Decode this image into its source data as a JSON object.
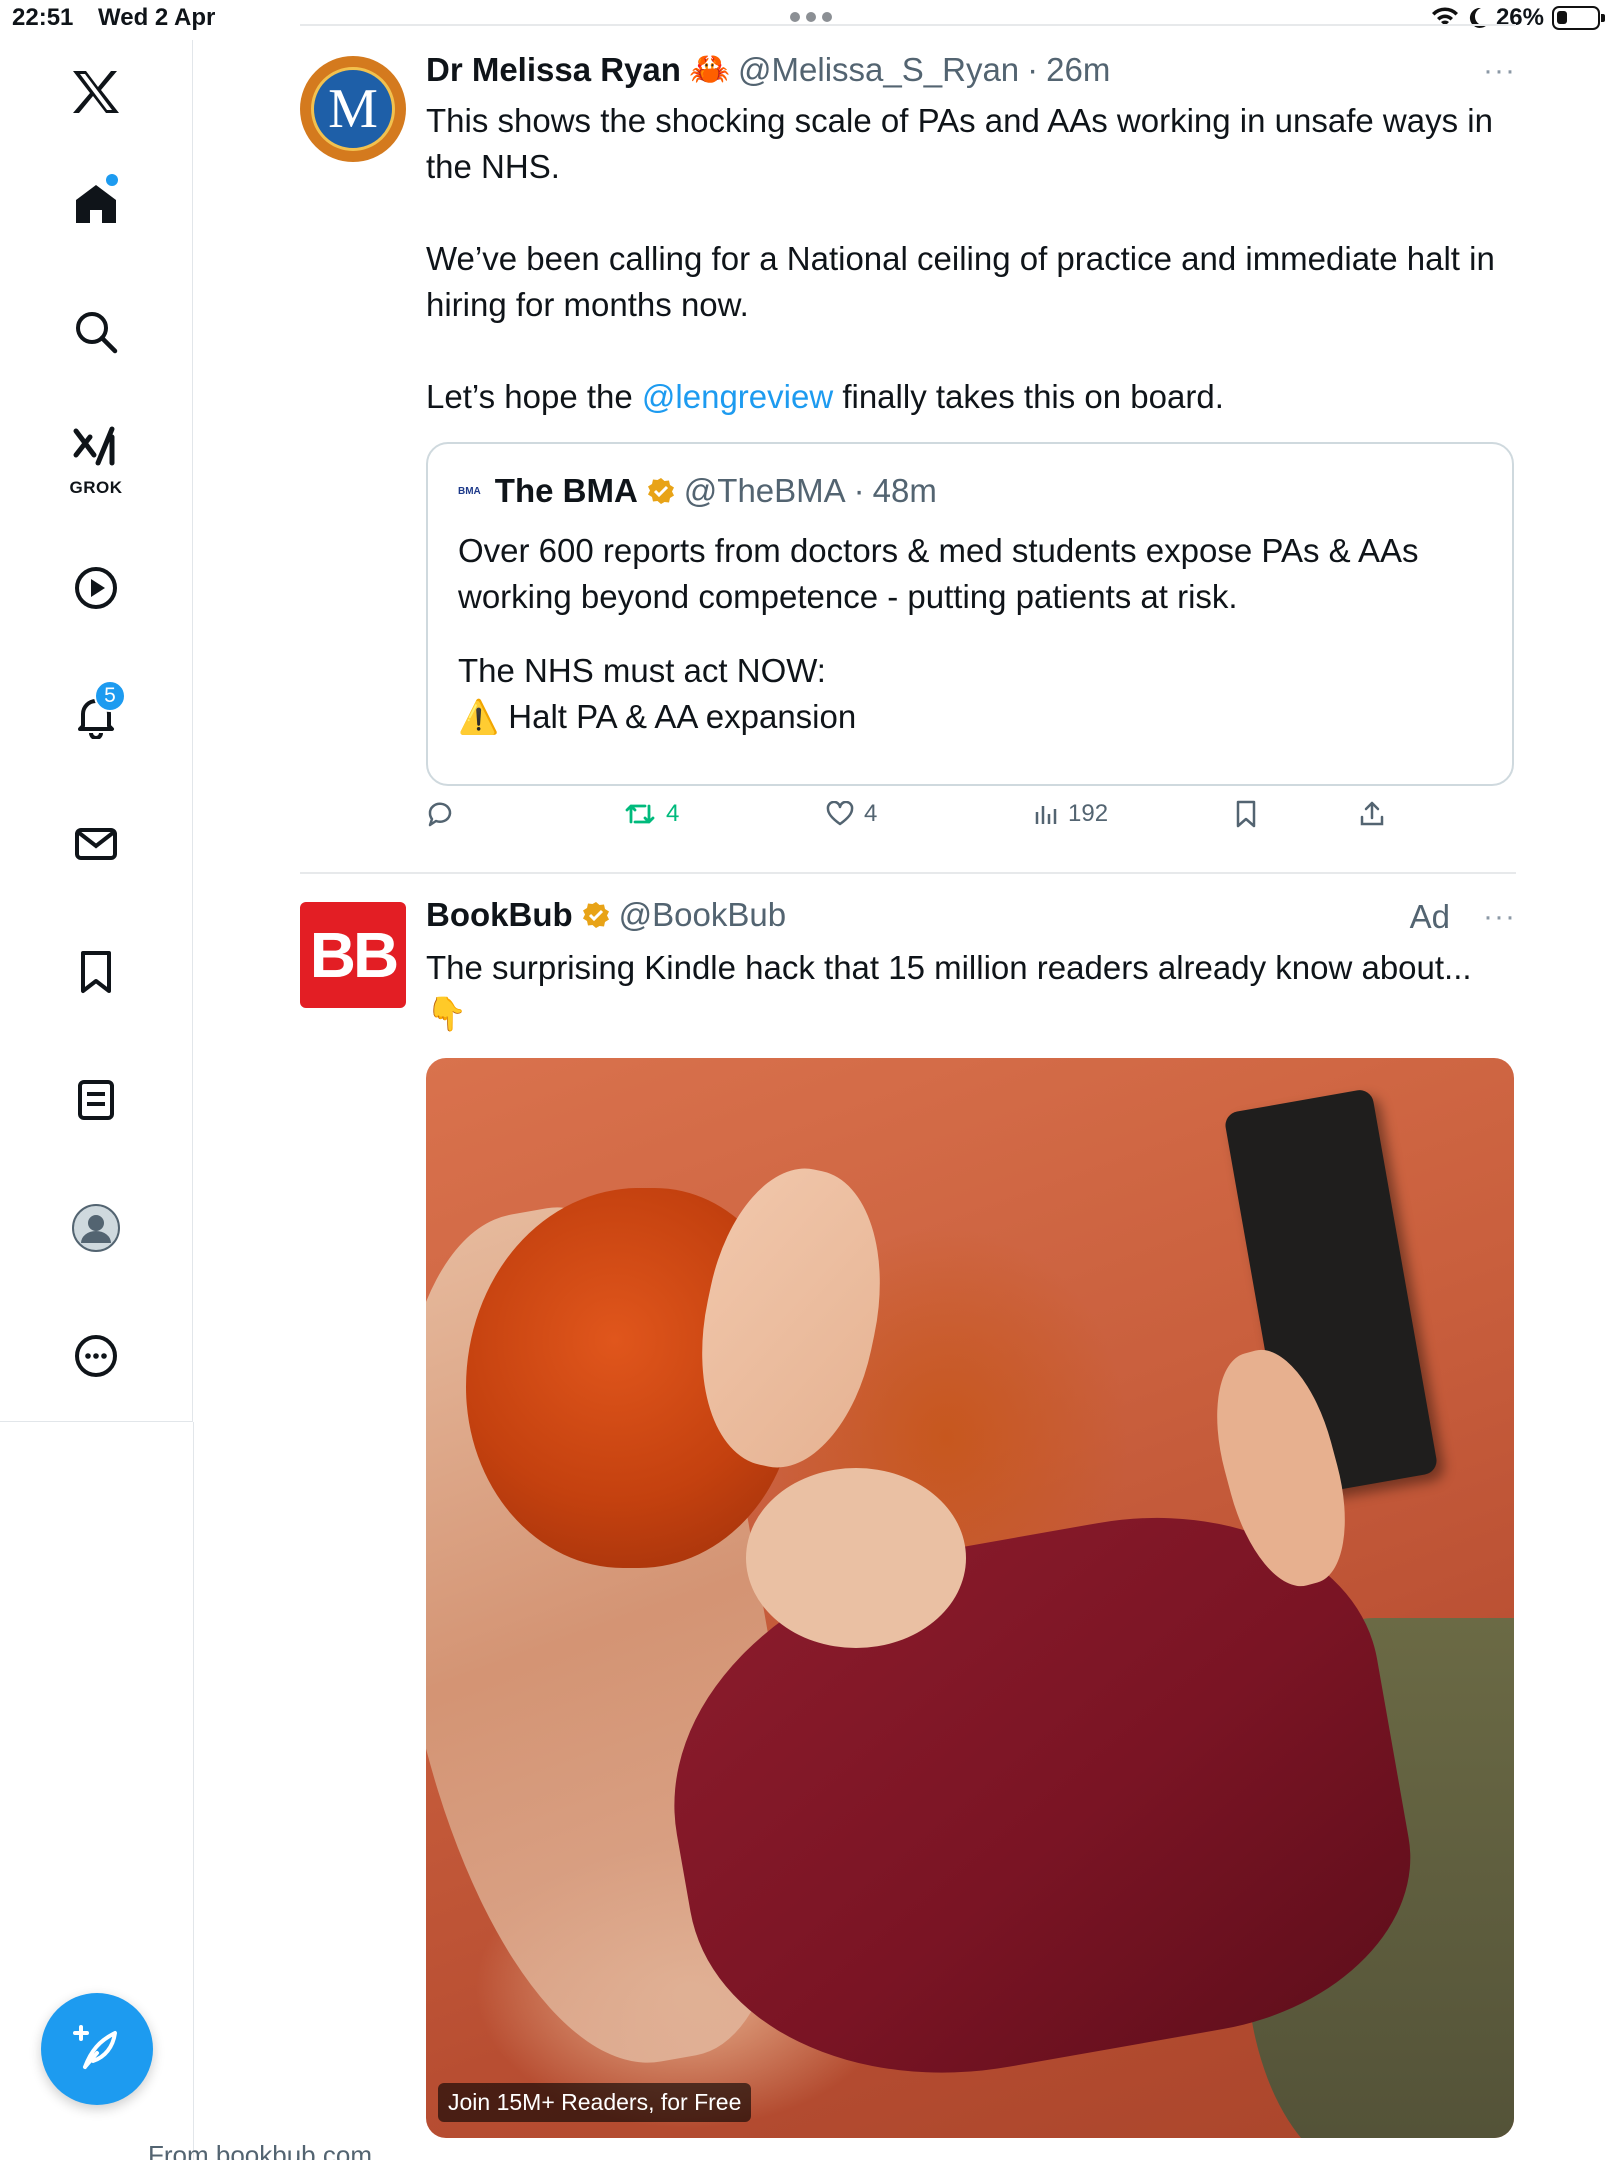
{
  "status_bar": {
    "time": "22:51",
    "date": "Wed 2 Apr",
    "battery_text": "26%",
    "battery_level": 0.26
  },
  "sidebar": {
    "items": [
      {
        "name": "x-logo",
        "icon": "x-logo-icon"
      },
      {
        "name": "home",
        "icon": "home-icon"
      },
      {
        "name": "search",
        "icon": "search-icon"
      },
      {
        "name": "grok",
        "icon": "grok-icon",
        "label": "GROK"
      },
      {
        "name": "video",
        "icon": "play-icon"
      },
      {
        "name": "notifications",
        "icon": "bell-icon",
        "badge": "5"
      },
      {
        "name": "messages",
        "icon": "mail-icon"
      },
      {
        "name": "bookmarks",
        "icon": "bookmark-icon"
      },
      {
        "name": "lists",
        "icon": "list-icon"
      },
      {
        "name": "profile",
        "icon": "profile-icon"
      },
      {
        "name": "more",
        "icon": "more-circle-icon"
      }
    ],
    "compose_icon": "compose-icon"
  },
  "tweets": [
    {
      "name": "Dr Melissa Ryan",
      "emoji": "🦀",
      "handle": "@Melissa_S_Ryan",
      "dot": "·",
      "time": "26m",
      "more": "···",
      "paragraphs": [
        "This shows the shocking scale of PAs and AAs working in unsafe ways in the NHS.",
        "We’ve been calling for a National ceiling of practice and immediate halt in hiring for months now."
      ],
      "last_prefix": "Let’s hope the ",
      "mention": "@lengreview",
      "last_suffix": " finally takes this on board.",
      "quote": {
        "logo": "BMA",
        "name": "The BMA",
        "handle": "@TheBMA",
        "dot": "·",
        "time": "48m",
        "p1": "Over 600 reports from doctors & med students expose PAs & AAs working beyond competence - putting patients at risk.",
        "p2": "The NHS must act NOW:",
        "p3": "⚠️ Halt PA & AA expansion"
      },
      "actions": {
        "replies": "",
        "retweets": "4",
        "likes": "4",
        "views": "192",
        "icons": [
          "reply-icon",
          "retweet-icon",
          "heart-icon",
          "views-icon",
          "bookmark-icon",
          "share-icon"
        ]
      }
    },
    {
      "name": "BookBub",
      "handle": "@BookBub",
      "avatar_text": "BB",
      "ad_label": "Ad",
      "more": "···",
      "text": "The surprising Kindle hack that 15 million readers already know about... 👇",
      "media_caption": "Join 15M+ Readers, for Free",
      "below_media": "From bookbub.com"
    }
  ],
  "colors": {
    "accent": "#1d9bf0",
    "retweet": "#00ba7c",
    "verified": "#e8a317",
    "bookbub_red": "#e31e24"
  }
}
